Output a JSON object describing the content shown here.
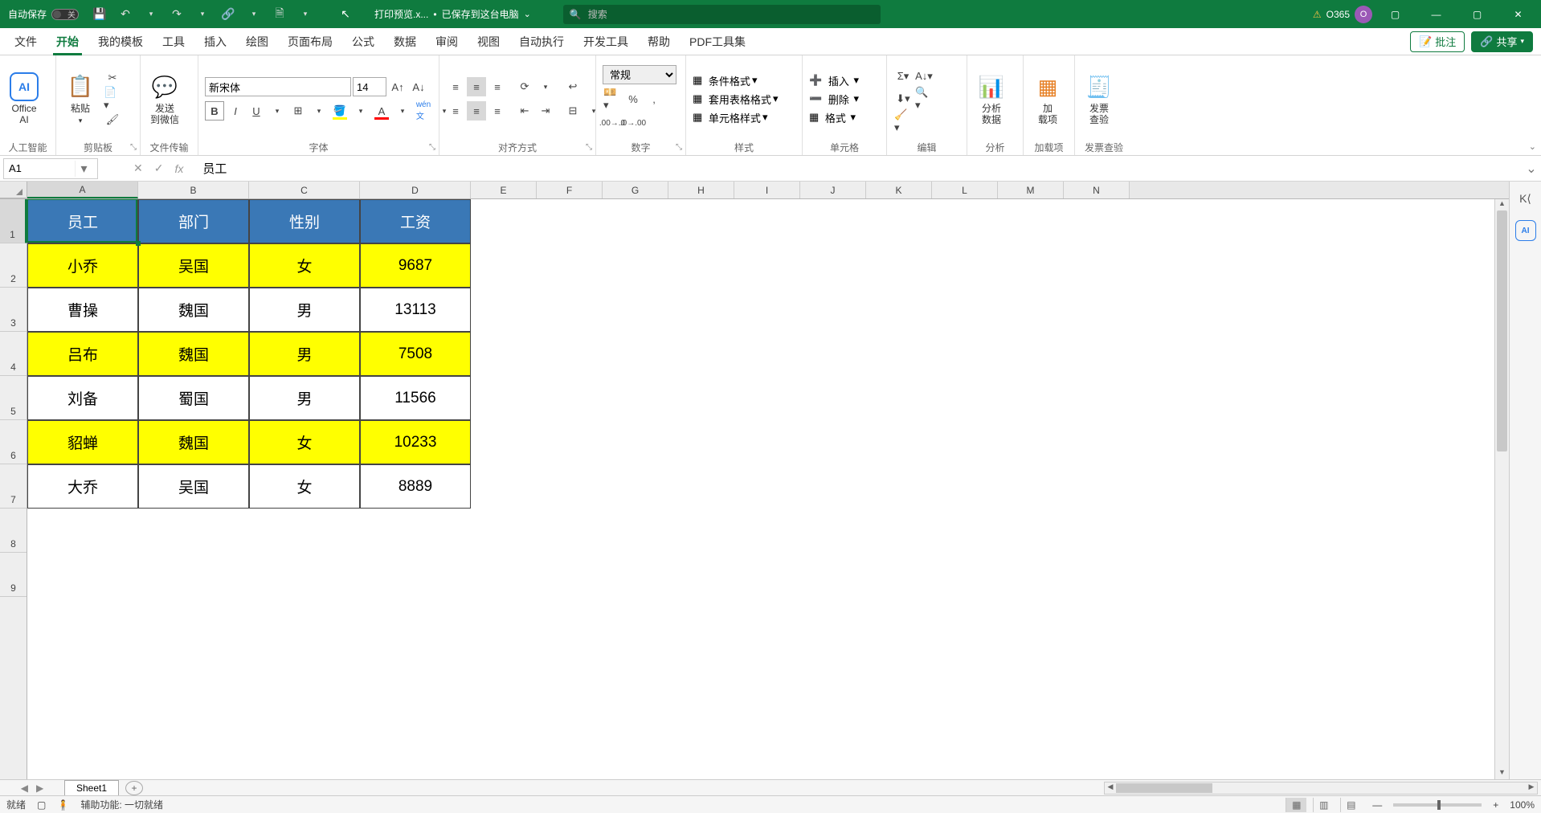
{
  "titlebar": {
    "autosave_label": "自动保存",
    "autosave_switch": "关",
    "file_name": "打印预览.x...",
    "saved_status": "已保存到这台电脑",
    "search_placeholder": "搜索",
    "account": "O365",
    "warning_icon": "⚠"
  },
  "menutabs": {
    "items": [
      "文件",
      "开始",
      "我的模板",
      "工具",
      "插入",
      "绘图",
      "页面布局",
      "公式",
      "数据",
      "审阅",
      "视图",
      "自动执行",
      "开发工具",
      "帮助",
      "PDF工具集"
    ],
    "active": "开始",
    "annotate_btn": "批注",
    "share_btn": "共享"
  },
  "ribbon": {
    "ai_group": {
      "btn": "Office\nAI",
      "label": "人工智能"
    },
    "clipboard": {
      "paste": "粘贴",
      "label": "剪贴板"
    },
    "filetransfer": {
      "btn": "发送\n到微信",
      "label": "文件传输"
    },
    "font": {
      "family": "新宋体",
      "size": "14",
      "label": "字体"
    },
    "align": {
      "label": "对齐方式"
    },
    "number": {
      "format": "常规",
      "label": "数字"
    },
    "styles": {
      "cond": "条件格式",
      "table": "套用表格格式",
      "cell": "单元格样式",
      "label": "样式"
    },
    "cells": {
      "insert": "插入",
      "delete": "删除",
      "format": "格式",
      "label": "单元格"
    },
    "editing": {
      "label": "编辑"
    },
    "analysis": {
      "btn": "分析\n数据",
      "label": "分析"
    },
    "addin": {
      "btn": "加\n载项",
      "label": "加载项"
    },
    "invoice": {
      "btn": "发票\n查验",
      "label": "发票查验"
    }
  },
  "formula_bar": {
    "name_box": "A1",
    "content": "员工"
  },
  "grid": {
    "columns": [
      "A",
      "B",
      "C",
      "D",
      "E",
      "F",
      "G",
      "H",
      "I",
      "J",
      "K",
      "L",
      "M",
      "N"
    ],
    "col_widths": {
      "data": 138,
      "rest": 82
    },
    "row_heights": {
      "data": 55,
      "rest": 55
    },
    "headers": [
      "员工",
      "部门",
      "性别",
      "工资"
    ],
    "rows": [
      {
        "yellow": true,
        "cells": [
          "小乔",
          "吴国",
          "女",
          "9687"
        ]
      },
      {
        "yellow": false,
        "cells": [
          "曹操",
          "魏国",
          "男",
          "13113"
        ]
      },
      {
        "yellow": true,
        "cells": [
          "吕布",
          "魏国",
          "男",
          "7508"
        ]
      },
      {
        "yellow": false,
        "cells": [
          "刘备",
          "蜀国",
          "男",
          "11566"
        ]
      },
      {
        "yellow": true,
        "cells": [
          "貂蝉",
          "魏国",
          "女",
          "10233"
        ]
      },
      {
        "yellow": false,
        "cells": [
          "大乔",
          "吴国",
          "女",
          "8889"
        ]
      }
    ],
    "selected_cell": "A1"
  },
  "sheets": {
    "active": "Sheet1"
  },
  "statusbar": {
    "ready": "就绪",
    "accessibility": "辅助功能: 一切就绪",
    "zoom": "100%"
  }
}
